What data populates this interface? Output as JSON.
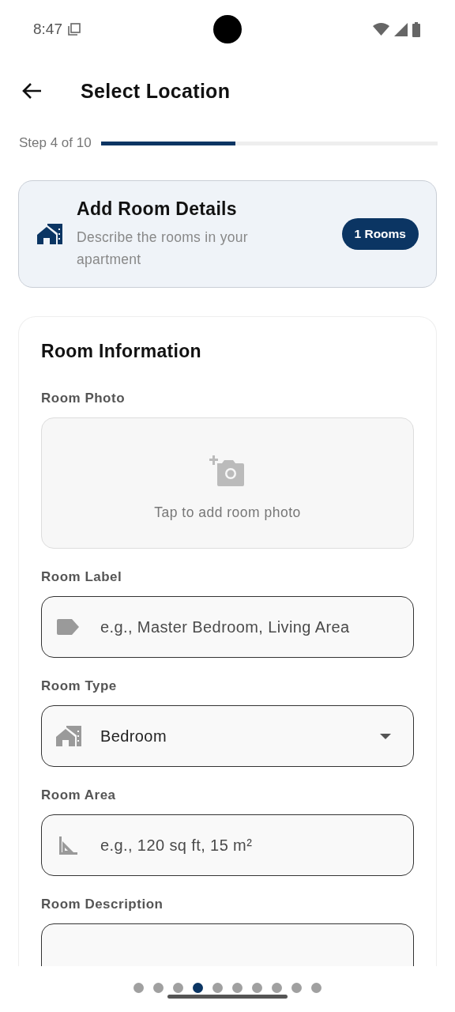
{
  "status_bar": {
    "time": "8:47"
  },
  "header": {
    "title": "Select Location"
  },
  "progress": {
    "label": "Step 4 of 10",
    "level": 0.4
  },
  "summary": {
    "title": "Add Room Details",
    "subtitle": "Describe the rooms in your apartment",
    "badge": "1 Rooms"
  },
  "form": {
    "title": "Room Information",
    "fields": [
      {
        "kind": "photo",
        "label": "Room Photo",
        "hint": "Tap to add room photo"
      },
      {
        "kind": "text",
        "label": "Room Label",
        "placeholder": "e.g., Master Bedroom, Living Area"
      },
      {
        "kind": "dropdown",
        "label": "Room Type",
        "value": "Bedroom"
      },
      {
        "kind": "text",
        "label": "Room Area",
        "placeholder": "e.g., 120 sq ft, 15 m²"
      },
      {
        "kind": "textarea",
        "label": "Room Description"
      }
    ]
  },
  "page_dots": [
    {
      "selected": false
    },
    {
      "selected": false
    },
    {
      "selected": false
    },
    {
      "selected": true
    },
    {
      "selected": false
    },
    {
      "selected": false
    },
    {
      "selected": false
    },
    {
      "selected": false
    },
    {
      "selected": false
    },
    {
      "selected": false
    }
  ]
}
